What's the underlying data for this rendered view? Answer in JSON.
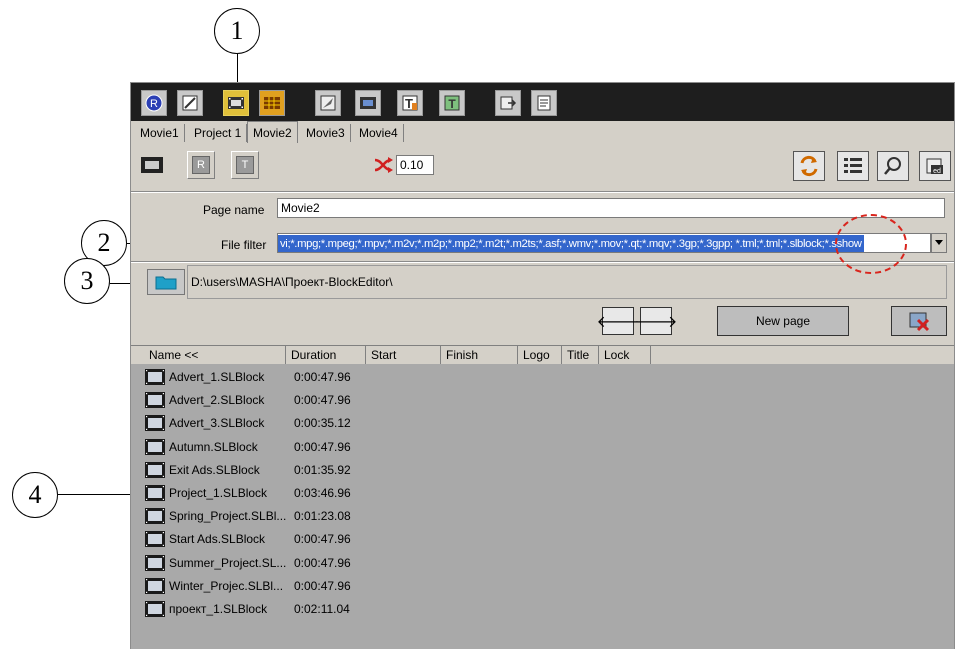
{
  "callouts": [
    "1",
    "2",
    "3",
    "4"
  ],
  "toolbar": {
    "buttons": [
      {
        "icon": "registered-icon"
      },
      {
        "icon": "pen-edit-icon"
      },
      {
        "icon": "film-icon"
      },
      {
        "icon": "grid-film-icon"
      },
      {
        "icon": "brush-icon"
      },
      {
        "icon": "film-effects-icon"
      },
      {
        "icon": "text-t-icon"
      },
      {
        "icon": "text-frame-icon"
      },
      {
        "icon": "export-icon"
      },
      {
        "icon": "document-icon"
      }
    ]
  },
  "tabs": [
    "Movie1",
    "Project 1",
    "Movie2",
    "Movie3",
    "Movie4"
  ],
  "upper": {
    "speed_value": "0.10",
    "page_name_label": "Page name",
    "page_name_value": "Movie2",
    "file_filter_label": "File filter",
    "file_filter_value": "vi;*.mpg;*.mpeg;*.mpv;*.m2v;*.m2p;*.mp2;*.m2t;*.m2ts;*.asf;*.wmv;*.mov;*.qt;*.mqv;*.3gp;*.3gpp; *.tml;*.tml;*.slblock;*.sshow",
    "folder_path": "D:\\users\\MASHA\\Проект-BlockEditor\\",
    "new_page_label": "New page",
    "prev_arrow": "🡐",
    "next_arrow": "🡒"
  },
  "columns": [
    "Name <<",
    "Duration",
    "Start",
    "Finish",
    "Logo",
    "Title",
    "Lock"
  ],
  "files": [
    {
      "name": "Advert_1.SLBlock",
      "duration": "0:00:47.96"
    },
    {
      "name": "Advert_2.SLBlock",
      "duration": "0:00:47.96"
    },
    {
      "name": "Advert_3.SLBlock",
      "duration": "0:00:35.12"
    },
    {
      "name": "Autumn.SLBlock",
      "duration": "0:00:47.96"
    },
    {
      "name": "Exit Ads.SLBlock",
      "duration": "0:01:35.92"
    },
    {
      "name": "Project_1.SLBlock",
      "duration": "0:03:46.96"
    },
    {
      "name": "Spring_Project.SLBl...",
      "duration": "0:01:23.08"
    },
    {
      "name": "Start Ads.SLBlock",
      "duration": "0:00:47.96"
    },
    {
      "name": "Summer_Project.SL...",
      "duration": "0:00:47.96"
    },
    {
      "name": "Winter_Projec.SLBl...",
      "duration": "0:00:47.96"
    },
    {
      "name": "проект_1.SLBlock",
      "duration": "0:02:11.04"
    }
  ],
  "colors": {
    "highlight": "#3366cc",
    "active_tool": "#e0c03a",
    "callout_red": "#d9251d"
  }
}
